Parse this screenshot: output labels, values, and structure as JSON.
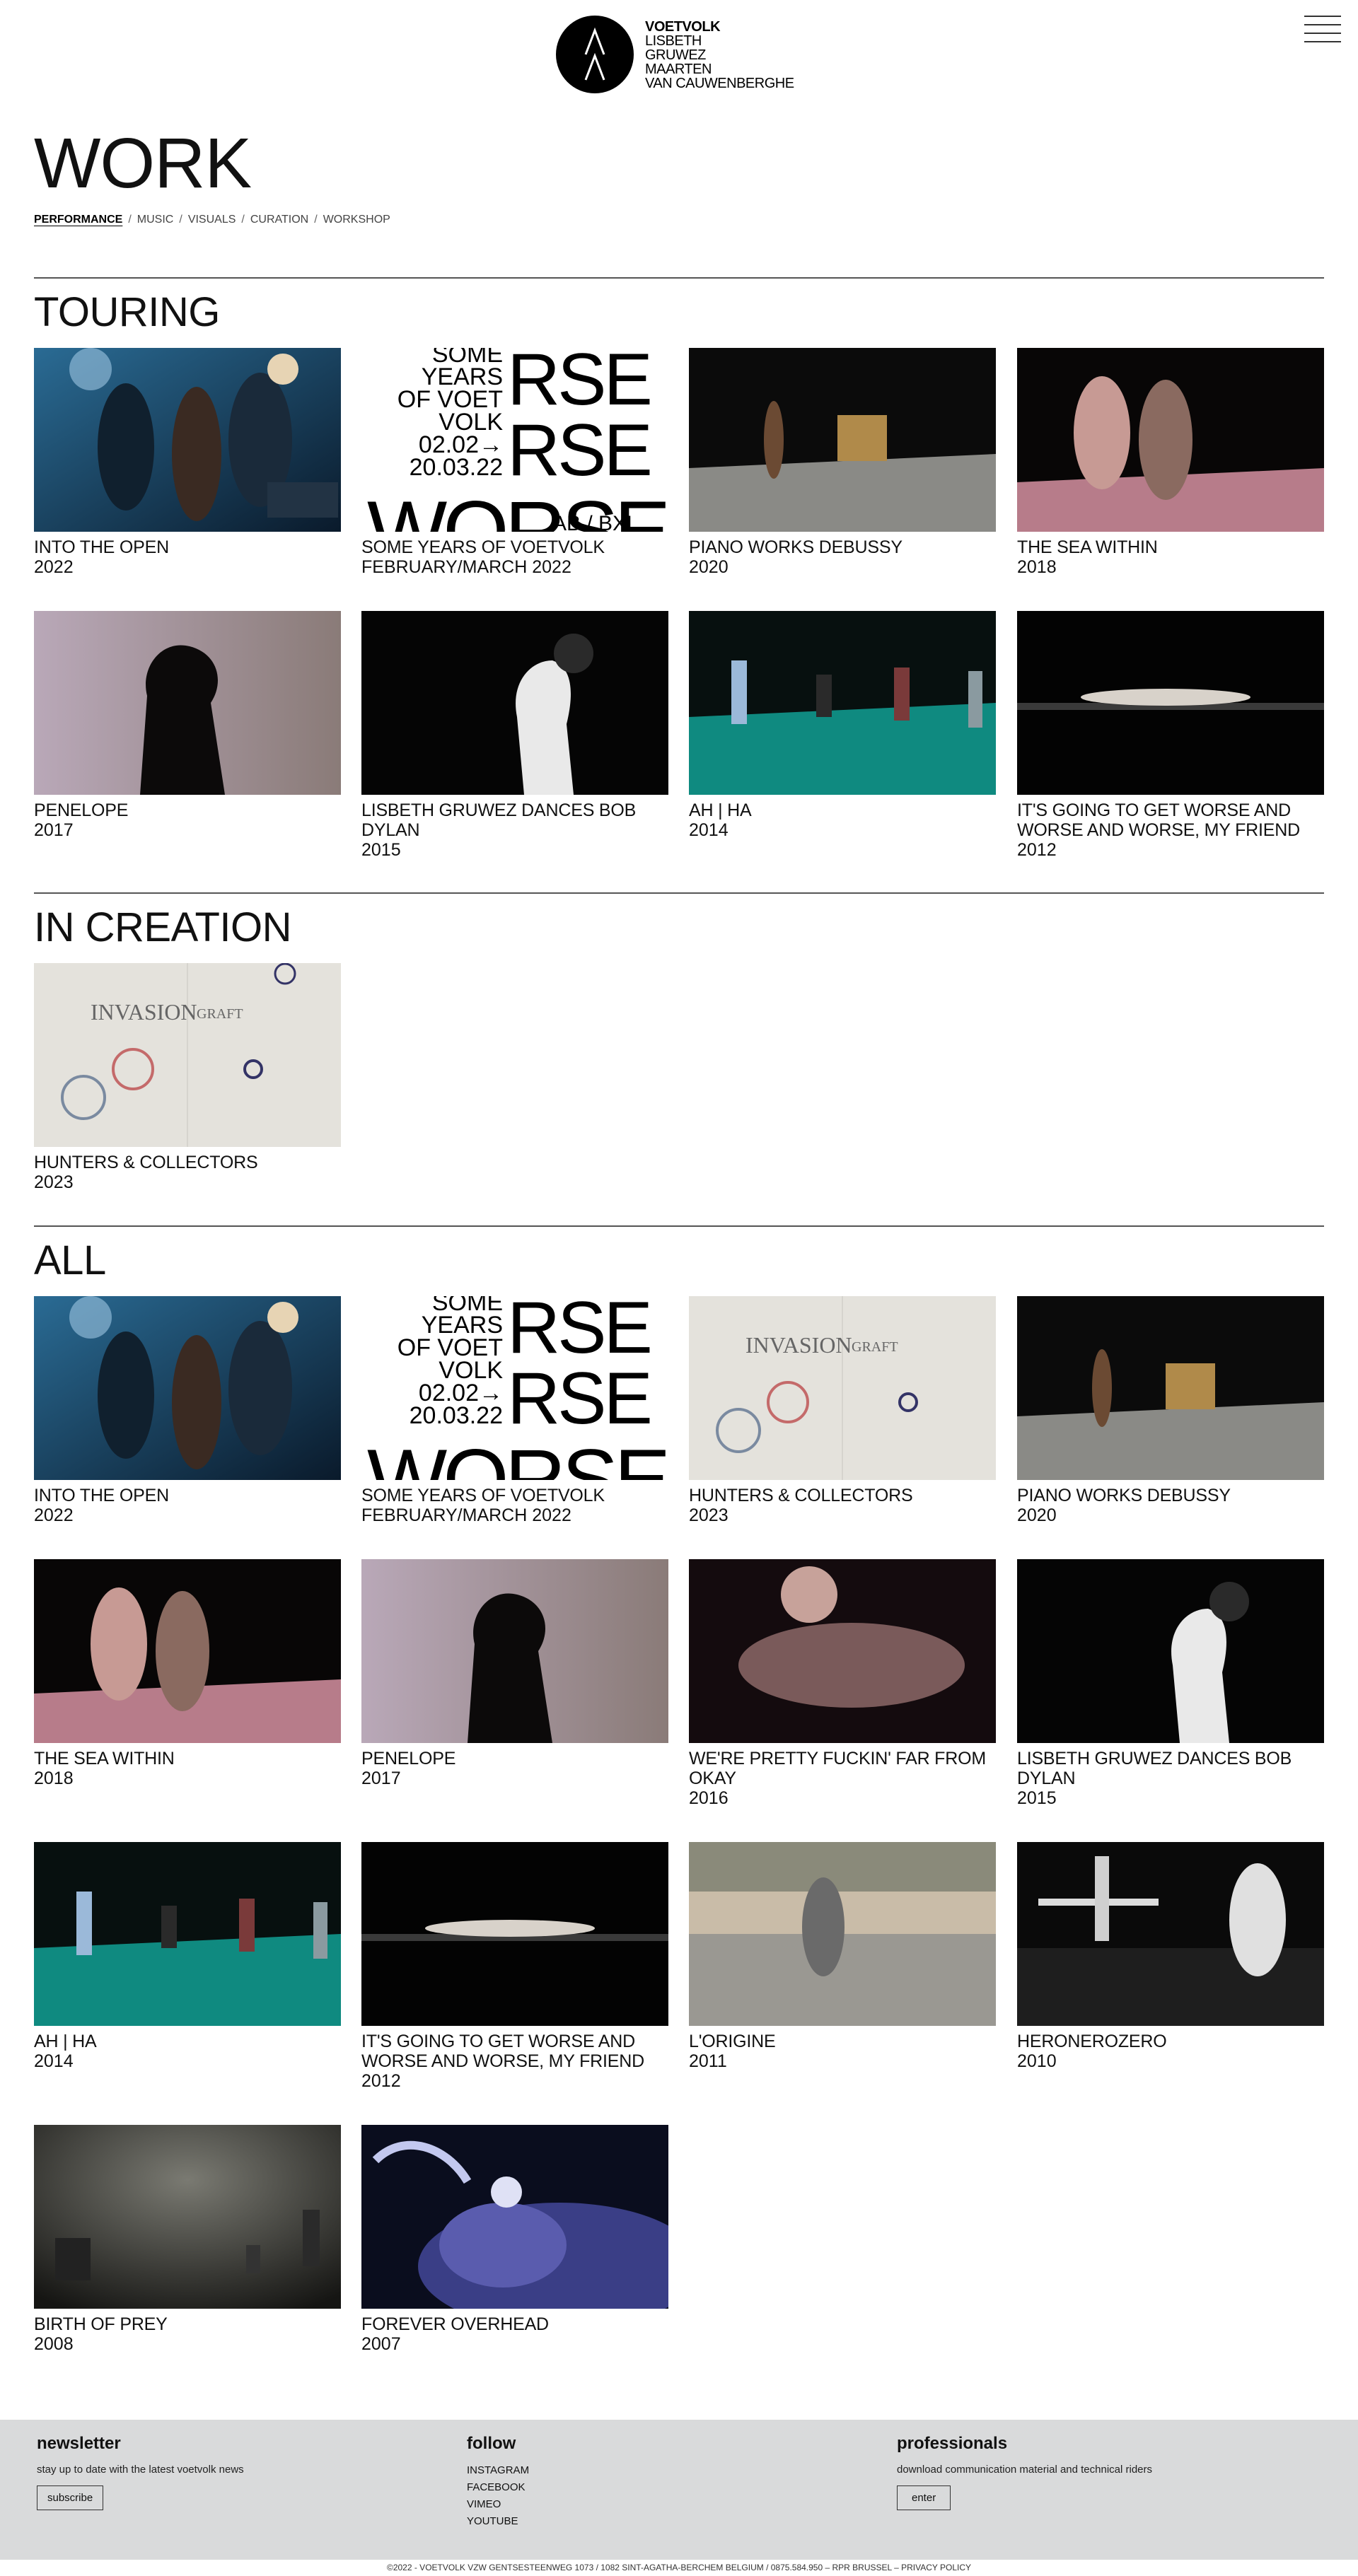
{
  "header": {
    "brand": "VOETVOLK",
    "names": [
      "LISBETH",
      "GRUWEZ",
      "MAARTEN",
      "VAN CAUWENBERGHE"
    ]
  },
  "page": {
    "title": "WORK"
  },
  "filters": [
    "PERFORMANCE",
    "MUSIC",
    "VISUALS",
    "CURATION",
    "WORKSHOP"
  ],
  "filters_separator": "/",
  "sections": {
    "touring": {
      "title": "TOURING",
      "items": [
        {
          "title": "INTO THE OPEN",
          "year": "2022"
        },
        {
          "title": "SOME YEARS OF VOETVOLK",
          "year": "FEBRUARY/MARCH 2022"
        },
        {
          "title": "PIANO WORKS DEBUSSY",
          "year": "2020"
        },
        {
          "title": "THE SEA WITHIN",
          "year": "2018"
        },
        {
          "title": "PENELOPE",
          "year": "2017"
        },
        {
          "title": "LISBETH GRUWEZ DANCES BOB DYLAN",
          "year": "2015"
        },
        {
          "title": "AH | HA",
          "year": "2014"
        },
        {
          "title": "IT'S GOING TO GET WORSE AND WORSE AND WORSE, MY FRIEND",
          "year": "2012"
        }
      ]
    },
    "creation": {
      "title": "IN CREATION",
      "items": [
        {
          "title": "HUNTERS & COLLECTORS",
          "year": "2023"
        }
      ]
    },
    "all": {
      "title": "ALL",
      "items": [
        {
          "title": "INTO THE OPEN",
          "year": "2022"
        },
        {
          "title": "SOME YEARS OF VOETVOLK",
          "year": "FEBRUARY/MARCH 2022"
        },
        {
          "title": "HUNTERS & COLLECTORS",
          "year": "2023"
        },
        {
          "title": "PIANO WORKS DEBUSSY",
          "year": "2020"
        },
        {
          "title": "THE SEA WITHIN",
          "year": "2018"
        },
        {
          "title": "PENELOPE",
          "year": "2017"
        },
        {
          "title": "WE'RE PRETTY FUCKIN' FAR FROM OKAY",
          "year": "2016"
        },
        {
          "title": "LISBETH GRUWEZ DANCES BOB DYLAN",
          "year": "2015"
        },
        {
          "title": "AH | HA",
          "year": "2014"
        },
        {
          "title": "IT'S GOING TO GET WORSE AND WORSE AND WORSE, MY FRIEND",
          "year": "2012"
        },
        {
          "title": "L'ORIGINE",
          "year": "2011"
        },
        {
          "title": "HERONEROZERO",
          "year": "2010"
        },
        {
          "title": "BIRTH OF PREY",
          "year": "2008"
        },
        {
          "title": "FOREVER OVERHEAD",
          "year": "2007"
        }
      ]
    }
  },
  "poster": {
    "lines": [
      "SOME",
      "YEARS",
      "OF VOET",
      "VOLK",
      "02.02→",
      "20.03.22"
    ],
    "big1": "RSE",
    "big2": "RSE",
    "big3": "WORSE",
    "tag": "AB / BXL"
  },
  "sketch": {
    "word1": "INVASION",
    "word2": "GRAFT"
  },
  "footer": {
    "newsletter": {
      "title": "newsletter",
      "text": "stay up to date with the latest voetvolk news",
      "button": "subscribe"
    },
    "follow": {
      "title": "follow",
      "links": [
        "INSTAGRAM",
        "FACEBOOK",
        "VIMEO",
        "YOUTUBE"
      ]
    },
    "professionals": {
      "title": "professionals",
      "text": "download communication material and technical riders",
      "button": "enter"
    },
    "legal": "©2022 - VOETVOLK VZW GENTSESTEENWEG 1073 / 1082 SINT-AGATHA-BERCHEM BELGIUM / 0875.584.950 – RPR BRUSSEL – PRIVACY POLICY"
  },
  "colors": {
    "teal_floor": "#0f8a80",
    "footer_bg": "#d9dadb"
  }
}
